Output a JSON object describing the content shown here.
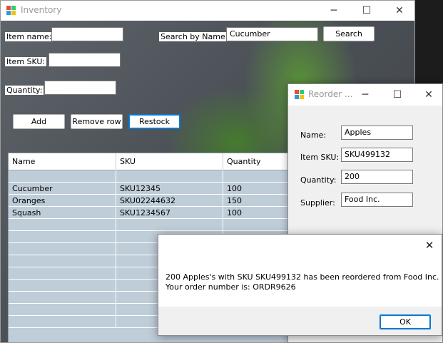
{
  "main_window": {
    "title": "Inventory",
    "caption_buttons": {
      "minimize": "─",
      "maximize": "☐",
      "close": "✕"
    },
    "labels": {
      "item_name": "Item name:",
      "item_sku": "Item SKU:",
      "quantity": "Quantity:",
      "search_by_name": "Search by Name:"
    },
    "inputs": {
      "item_name": "",
      "item_sku": "",
      "quantity": "",
      "search": "Cucumber"
    },
    "buttons": {
      "search": "Search",
      "add": "Add",
      "remove_row": "Remove row",
      "restock": "Restock"
    },
    "grid": {
      "columns": [
        "Name",
        "SKU",
        "Quantity"
      ],
      "rows": [
        [
          "",
          "",
          ""
        ],
        [
          "Cucumber",
          "SKU12345",
          "100"
        ],
        [
          "Oranges",
          "SKU02244632",
          "150"
        ],
        [
          "Squash",
          "SKU1234567",
          "100"
        ],
        [
          "",
          "",
          ""
        ],
        [
          "",
          "",
          ""
        ],
        [
          "",
          "",
          ""
        ],
        [
          "",
          "",
          ""
        ],
        [
          "",
          "",
          ""
        ],
        [
          "",
          "",
          ""
        ],
        [
          "",
          "",
          ""
        ],
        [
          "",
          "",
          ""
        ],
        [
          "",
          "",
          ""
        ]
      ]
    }
  },
  "reorder_window": {
    "title": "Reorder ...",
    "caption_buttons": {
      "minimize": "─",
      "maximize": "☐",
      "close": "✕"
    },
    "labels": {
      "name": "Name:",
      "item_sku": "Item SKU:",
      "quantity": "Quantity:",
      "supplier": "Supplier:"
    },
    "inputs": {
      "name": "Apples",
      "item_sku": "SKU499132",
      "quantity": "200",
      "supplier": "Food Inc."
    }
  },
  "message_box": {
    "close": "✕",
    "line1": "200 Apples's with SKU SKU499132 has been reordered from Food Inc.",
    "line2": "Your order number is: ORDR9626",
    "ok_label": "OK"
  },
  "colors": {
    "grid_background": "#bfcdd9",
    "focus_accent": "#0078d4",
    "titlebar_text": "#9a9a9a"
  },
  "icons": {
    "app": "winforms-app-icon"
  }
}
